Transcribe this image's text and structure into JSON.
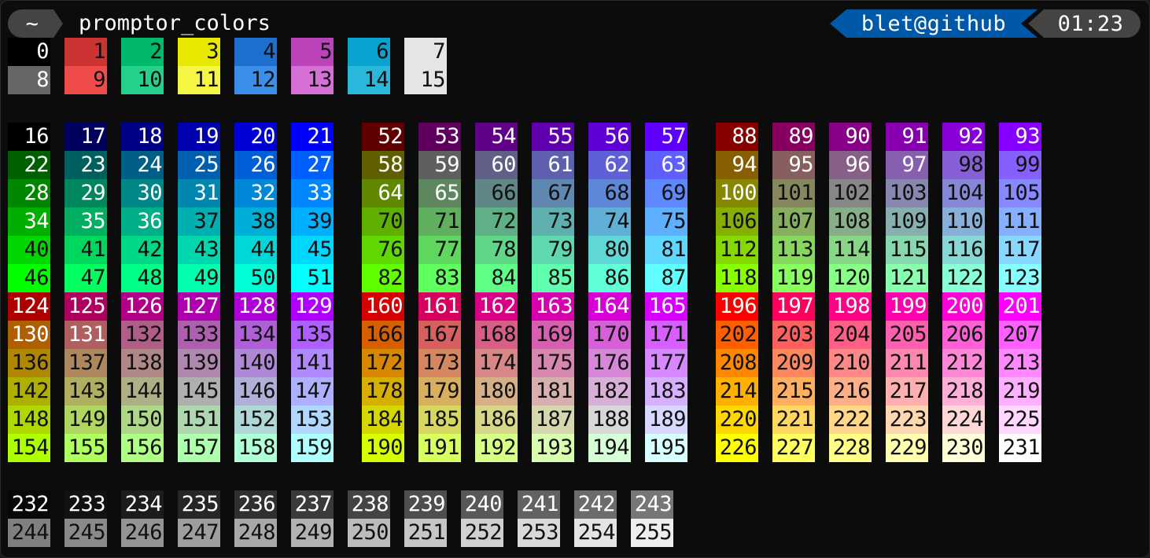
{
  "prompt": {
    "dir_label": "~",
    "title": "promptor_colors",
    "user_host": "blet@github",
    "time": "01:23"
  },
  "colors": {
    "prompt_dir_bg": "#444444",
    "prompt_user_bg": "#0058a8",
    "prompt_time_bg": "#444444",
    "terminal_bg": "#0c0c0c",
    "ansi": [
      "#000000",
      "#cc3333",
      "#00b96b",
      "#e8e800",
      "#1f6fd1",
      "#bb44bb",
      "#0aa3cf",
      "#e5e5e5",
      "#666666",
      "#f14c4c",
      "#23d18b",
      "#f5f543",
      "#3b8eea",
      "#d670d6",
      "#29b8db",
      "#e5e5e5"
    ]
  },
  "labels": {
    "ansi_rows": [
      [
        "0",
        "1",
        "2",
        "3",
        "4",
        "5",
        "6",
        "7"
      ],
      [
        "8",
        "9",
        "10",
        "11",
        "12",
        "13",
        "14",
        "15"
      ]
    ],
    "cube": [
      [
        "16",
        "17",
        "18",
        "19",
        "20",
        "21",
        "52",
        "53",
        "54",
        "55",
        "56",
        "57",
        "88",
        "89",
        "90",
        "91",
        "92",
        "93"
      ],
      [
        "22",
        "23",
        "24",
        "25",
        "26",
        "27",
        "58",
        "59",
        "60",
        "61",
        "62",
        "63",
        "94",
        "95",
        "96",
        "97",
        "98",
        "99"
      ],
      [
        "28",
        "29",
        "30",
        "31",
        "32",
        "33",
        "64",
        "65",
        "66",
        "67",
        "68",
        "69",
        "100",
        "101",
        "102",
        "103",
        "104",
        "105"
      ],
      [
        "34",
        "35",
        "36",
        "37",
        "38",
        "39",
        "70",
        "71",
        "72",
        "73",
        "74",
        "75",
        "106",
        "107",
        "108",
        "109",
        "110",
        "111"
      ],
      [
        "40",
        "41",
        "42",
        "43",
        "44",
        "45",
        "76",
        "77",
        "78",
        "79",
        "80",
        "81",
        "112",
        "113",
        "114",
        "115",
        "116",
        "117"
      ],
      [
        "46",
        "47",
        "48",
        "49",
        "50",
        "51",
        "82",
        "83",
        "84",
        "85",
        "86",
        "87",
        "118",
        "119",
        "120",
        "121",
        "122",
        "123"
      ],
      [
        "124",
        "125",
        "126",
        "127",
        "128",
        "129",
        "160",
        "161",
        "162",
        "163",
        "164",
        "165",
        "196",
        "197",
        "198",
        "199",
        "200",
        "201"
      ],
      [
        "130",
        "131",
        "132",
        "133",
        "134",
        "135",
        "166",
        "167",
        "168",
        "169",
        "170",
        "171",
        "202",
        "203",
        "204",
        "205",
        "206",
        "207"
      ],
      [
        "136",
        "137",
        "138",
        "139",
        "140",
        "141",
        "172",
        "173",
        "174",
        "175",
        "176",
        "177",
        "208",
        "209",
        "210",
        "211",
        "212",
        "213"
      ],
      [
        "142",
        "143",
        "144",
        "145",
        "146",
        "147",
        "178",
        "179",
        "180",
        "181",
        "182",
        "183",
        "214",
        "215",
        "216",
        "217",
        "218",
        "219"
      ],
      [
        "148",
        "149",
        "150",
        "151",
        "152",
        "153",
        "184",
        "185",
        "186",
        "187",
        "188",
        "189",
        "220",
        "221",
        "222",
        "223",
        "224",
        "225"
      ],
      [
        "154",
        "155",
        "156",
        "157",
        "158",
        "159",
        "190",
        "191",
        "192",
        "193",
        "194",
        "195",
        "226",
        "227",
        "228",
        "229",
        "230",
        "231"
      ]
    ],
    "gray_rows": [
      [
        "232",
        "233",
        "234",
        "235",
        "236",
        "237",
        "238",
        "239",
        "240",
        "241",
        "242",
        "243"
      ],
      [
        "244",
        "245",
        "246",
        "247",
        "248",
        "249",
        "250",
        "251",
        "252",
        "253",
        "254",
        "255"
      ]
    ]
  }
}
